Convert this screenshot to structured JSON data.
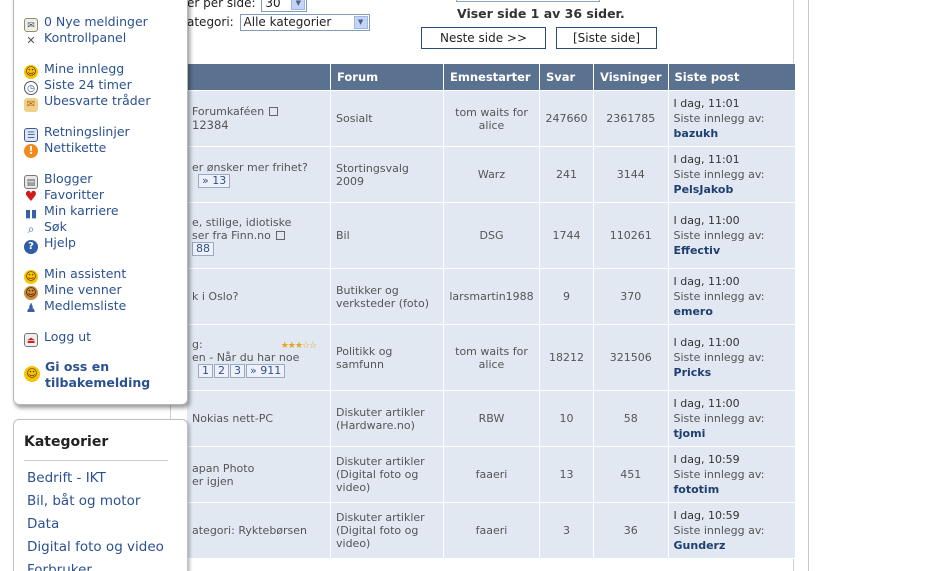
{
  "controls": {
    "per_page_label": "er per side:",
    "per_page_value": "30",
    "category_label": "ategori:",
    "category_value": "Alle kategorier"
  },
  "pagination": {
    "info": "Viser side 1 av 36 sider.",
    "next_label": "Neste side >>",
    "last_label": "[Siste side]"
  },
  "table": {
    "headers": {
      "forum": "Forum",
      "starter": "Emnestarter",
      "replies": "Svar",
      "views": "Visninger",
      "last": "Siste post"
    },
    "last_prefix": "Siste innlegg av:",
    "rows": [
      {
        "title": "Forumkaféen",
        "title2": "12384",
        "forum": "Sosialt",
        "starter": "tom waits for alice",
        "replies": "247660",
        "views": "2361785",
        "time": "I dag, 11:01",
        "author": "bazukh"
      },
      {
        "title": "er ønsker mer frihet?",
        "pages": [
          "» 13"
        ],
        "forum": "Stortingsvalg 2009",
        "starter": "Warz",
        "replies": "241",
        "views": "3144",
        "time": "I dag, 11:01",
        "author": "PelsJakob"
      },
      {
        "title": "e, stilige, idiotiske",
        "title2": "ser fra Finn.no",
        "pages": [
          "88"
        ],
        "forum": "Bil",
        "starter": "DSG",
        "replies": "1744",
        "views": "110261",
        "time": "I dag, 11:00",
        "author": "Effectiv"
      },
      {
        "title": "k i Oslo?",
        "forum": "Butikker og verksteder (foto)",
        "starter": "larsmartin1988",
        "replies": "9",
        "views": "370",
        "time": "I dag, 11:00",
        "author": "emero"
      },
      {
        "title": "g:",
        "title2": "en - Når du har noe",
        "pages": [
          "1",
          "2",
          "3",
          "» 911"
        ],
        "forum": "Politikk og samfunn",
        "starter": "tom waits for alice",
        "replies": "18212",
        "views": "321506",
        "time": "I dag, 11:00",
        "author": "Pricks"
      },
      {
        "title": "Nokias nett-PC",
        "forum": "Diskuter artikler (Hardware.no)",
        "starter": "RBW",
        "replies": "10",
        "views": "58",
        "time": "I dag, 11:00",
        "author": "tjomi"
      },
      {
        "title": "apan Photo",
        "title2": "er igjen",
        "forum": "Diskuter artikler (Digital foto og video)",
        "starter": "faaeri",
        "replies": "13",
        "views": "451",
        "time": "I dag, 10:59",
        "author": "fototim"
      },
      {
        "title": "ategori: Ryktebørsen",
        "forum": "Diskuter artikler (Digital foto og video)",
        "starter": "faaeri",
        "replies": "3",
        "views": "36",
        "time": "I dag, 10:59",
        "author": "Gunderz"
      }
    ]
  },
  "menu": {
    "items": [
      {
        "label": "0 Nye meldinger",
        "icon": "envelope-icon"
      },
      {
        "label": "Kontrollpanel",
        "icon": "wrench-icon"
      },
      {
        "label": "Mine innlegg",
        "icon": "smiley-icon"
      },
      {
        "label": "Siste 24 timer",
        "icon": "clock-icon"
      },
      {
        "label": "Ubesvarte tråder",
        "icon": "mail-open-icon"
      },
      {
        "label": "Retningslinjer",
        "icon": "rules-icon"
      },
      {
        "label": "Nettikette",
        "icon": "warning-icon"
      },
      {
        "label": "Blogger",
        "icon": "blog-icon"
      },
      {
        "label": "Favoritter",
        "icon": "heart-icon"
      },
      {
        "label": "Min karriere",
        "icon": "footprints-icon"
      },
      {
        "label": "Søk",
        "icon": "magnifier-icon"
      },
      {
        "label": "Hjelp",
        "icon": "help-icon"
      },
      {
        "label": "Min assistent",
        "icon": "assistant-smiley-icon"
      },
      {
        "label": "Mine venner",
        "icon": "friends-icon"
      },
      {
        "label": "Medlemsliste",
        "icon": "members-icon"
      },
      {
        "label": "Logg ut",
        "icon": "logout-icon"
      }
    ],
    "feedback": "Gi oss en tilbakemelding"
  },
  "categories": {
    "title": "Kategorier",
    "items": [
      "Bedrift - IKT",
      "Bil, båt og motor",
      "Data",
      "Digital foto og video",
      "Forbruker"
    ]
  }
}
